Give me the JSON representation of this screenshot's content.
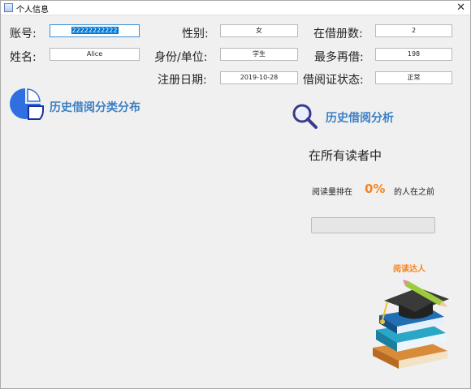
{
  "window": {
    "title": "个人信息",
    "close_glyph": "✕"
  },
  "labels": {
    "account": "账号:",
    "name": "姓名:",
    "gender": "性别:",
    "identity": "身份/单位:",
    "register_date": "注册日期:",
    "borrowed_count": "在借册数:",
    "max_borrow": "最多再借:",
    "borrow_status": "借阅证状态:"
  },
  "fields": {
    "account": "22222222222",
    "name": "Alice",
    "gender": "女",
    "identity": "学生",
    "register_date": "2019-10-28",
    "borrowed_count": "2",
    "max_borrow": "198",
    "borrow_status": "正常"
  },
  "sections": {
    "category_title": "历史借阅分类分布",
    "analysis_title": "历史借阅分析"
  },
  "analysis": {
    "among_readers": "在所有读者中",
    "rank_prefix": "阅读量排在",
    "rank_percent": "0%",
    "rank_suffix": "的人在之前",
    "progress_value": 0,
    "badge": "阅读达人"
  },
  "icons": {
    "title_icon": "window-app-icon",
    "pie": "pie-chart-icon",
    "magnifier": "magnifier-icon",
    "books": "books-graduation-cap-icon"
  },
  "colors": {
    "accent_blue": "#3b7fc4",
    "accent_orange": "#f5861f",
    "pie_blue": "#2f6fe0",
    "progress_green": "#06b025"
  }
}
